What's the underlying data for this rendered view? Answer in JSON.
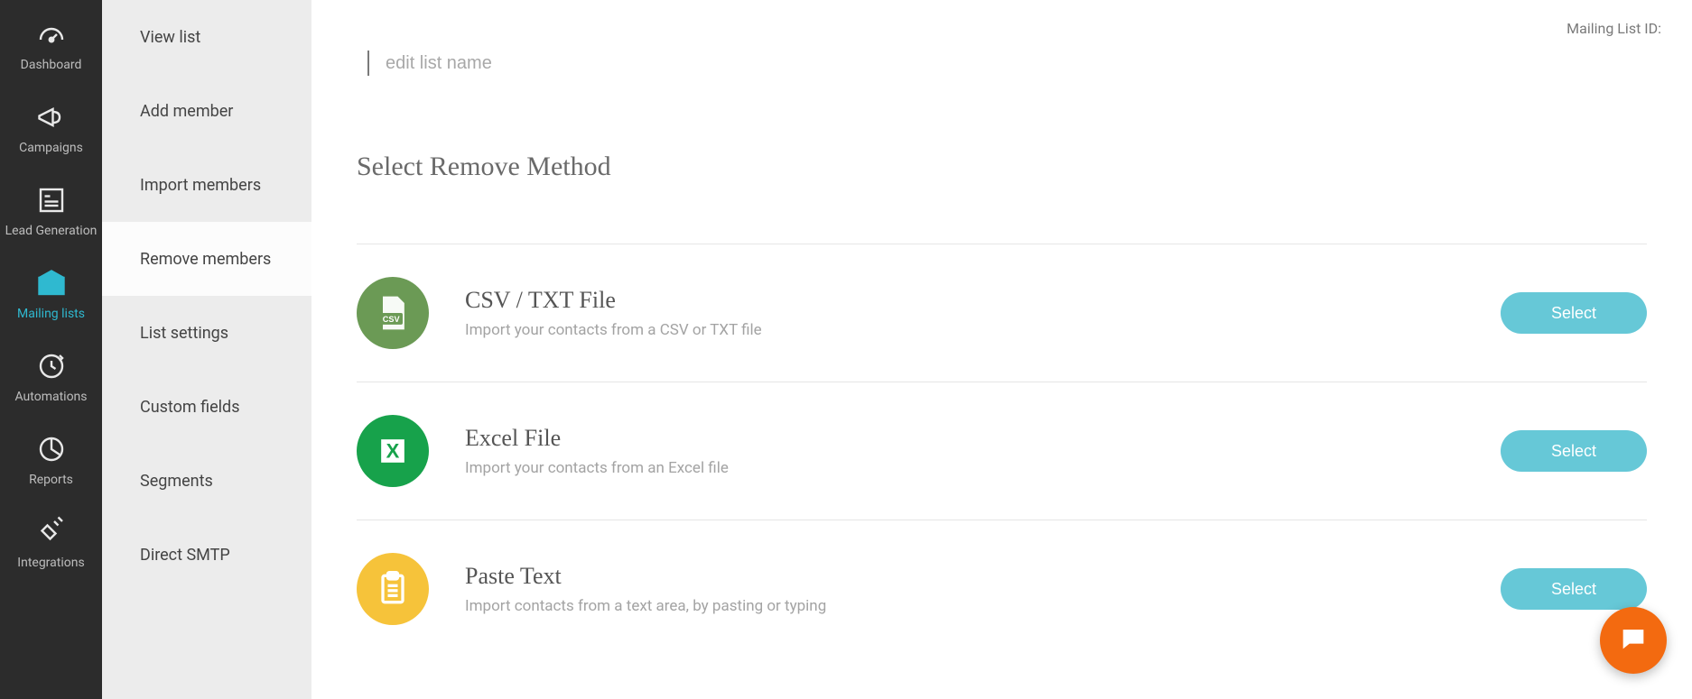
{
  "nav_primary": [
    {
      "key": "dashboard",
      "label": "Dashboard",
      "active": false
    },
    {
      "key": "campaigns",
      "label": "Campaigns",
      "active": false
    },
    {
      "key": "leadgen",
      "label": "Lead Generation",
      "active": false
    },
    {
      "key": "mailinglists",
      "label": "Mailing lists",
      "active": true
    },
    {
      "key": "automations",
      "label": "Automations",
      "active": false
    },
    {
      "key": "reports",
      "label": "Reports",
      "active": false
    },
    {
      "key": "integrations",
      "label": "Integrations",
      "active": false
    }
  ],
  "nav_secondary": [
    {
      "label": "View list",
      "active": false
    },
    {
      "label": "Add member",
      "active": false
    },
    {
      "label": "Import members",
      "active": false
    },
    {
      "label": "Remove members",
      "active": true
    },
    {
      "label": "List settings",
      "active": false
    },
    {
      "label": "Custom fields",
      "active": false
    },
    {
      "label": "Segments",
      "active": false
    },
    {
      "label": "Direct SMTP",
      "active": false
    }
  ],
  "header": {
    "mailing_id_label": "Mailing List ID:",
    "list_name_placeholder": "edit list name"
  },
  "section": {
    "title": "Select Remove Method"
  },
  "methods": [
    {
      "key": "csv",
      "title": "CSV / TXT File",
      "desc": "Import your contacts from a CSV or TXT file",
      "button": "Select"
    },
    {
      "key": "excel",
      "title": "Excel File",
      "desc": "Import your contacts from an Excel file",
      "button": "Select"
    },
    {
      "key": "paste",
      "title": "Paste Text",
      "desc": "Import contacts from a text area, by pasting or typing",
      "button": "Select"
    }
  ]
}
